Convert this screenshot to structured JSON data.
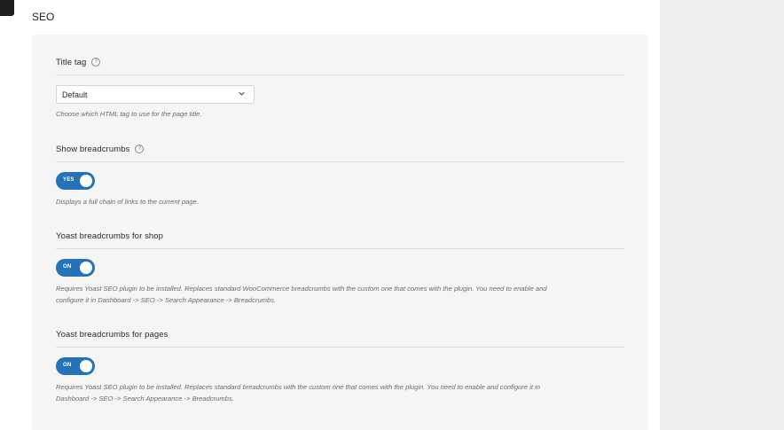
{
  "section": {
    "title": "SEO"
  },
  "fields": {
    "title_tag": {
      "label": "Title tag",
      "help": "?",
      "select_value": "Default",
      "description": "Choose which HTML tag to use for the page title."
    },
    "show_breadcrumbs": {
      "label": "Show breadcrumbs",
      "help": "?",
      "toggle_text": "YES",
      "toggle_on": true,
      "description": "Displays a full chain of links to the current page."
    },
    "yoast_shop": {
      "label": "Yoast breadcrumbs for shop",
      "toggle_text": "ON",
      "toggle_on": true,
      "description_line1": "Requires Yoast SEO plugin to be installed. Replaces standard WooCommerce breadcrumbs with the custom one that comes with the plugin. You need to enable and",
      "description_line2": "configure it in Dashboard -> SEO -> Search Appearance -> Breadcrumbs."
    },
    "yoast_pages": {
      "label": "Yoast breadcrumbs for pages",
      "toggle_text": "ON",
      "toggle_on": true,
      "description_line1": "Requires Yoast SEO plugin to be installed. Replaces standard breadcrumbs with the custom one that comes with the plugin. You need to enable and configure it in",
      "description_line2": "Dashboard -> SEO -> Search Appearance -> Breadcrumbs."
    }
  },
  "colors": {
    "accent": "#2473b8",
    "panel": "#f5f5f5",
    "gutter": "#f0f0f0"
  },
  "icons": {
    "help": "help-circle-icon",
    "select": "chevron-down-icon"
  }
}
